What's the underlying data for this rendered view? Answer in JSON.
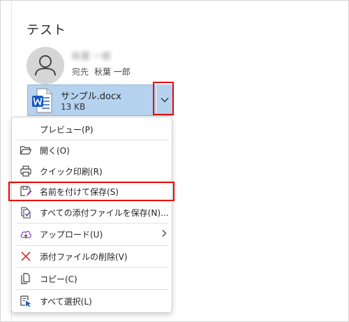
{
  "email": {
    "subject": "テスト",
    "sender_name": "秋葉 一郎",
    "to_label": "宛先",
    "to_name": "秋葉 一郎"
  },
  "attachment": {
    "filename": "サンプル.docx",
    "size": "13 KB",
    "icon": "word-doc-icon"
  },
  "menu": {
    "items": [
      {
        "label": "プレビュー(P)",
        "icon": ""
      },
      {
        "label": "開く(O)",
        "icon": "folder-open-icon"
      },
      {
        "label": "クイック印刷(R)",
        "icon": "printer-icon"
      },
      {
        "label": "名前を付けて保存(S)",
        "icon": "save-as-icon"
      },
      {
        "label": "すべての添付ファイルを保存(N)...",
        "icon": "save-all-icon"
      },
      {
        "label": "アップロード(U)",
        "icon": "cloud-upload-icon",
        "submenu": true
      },
      {
        "label": "添付ファイルの削除(V)",
        "icon": "delete-x-icon"
      },
      {
        "label": "コピー(C)",
        "icon": "copy-icon"
      },
      {
        "label": "すべて選択(L)",
        "icon": "select-all-icon"
      }
    ]
  },
  "colors": {
    "attachment_bg": "#b5d3ef",
    "highlight": "#ee0000",
    "icon_blue": "#185abd",
    "icon_purple": "#8a3fbf",
    "delete_red": "#d13438"
  }
}
